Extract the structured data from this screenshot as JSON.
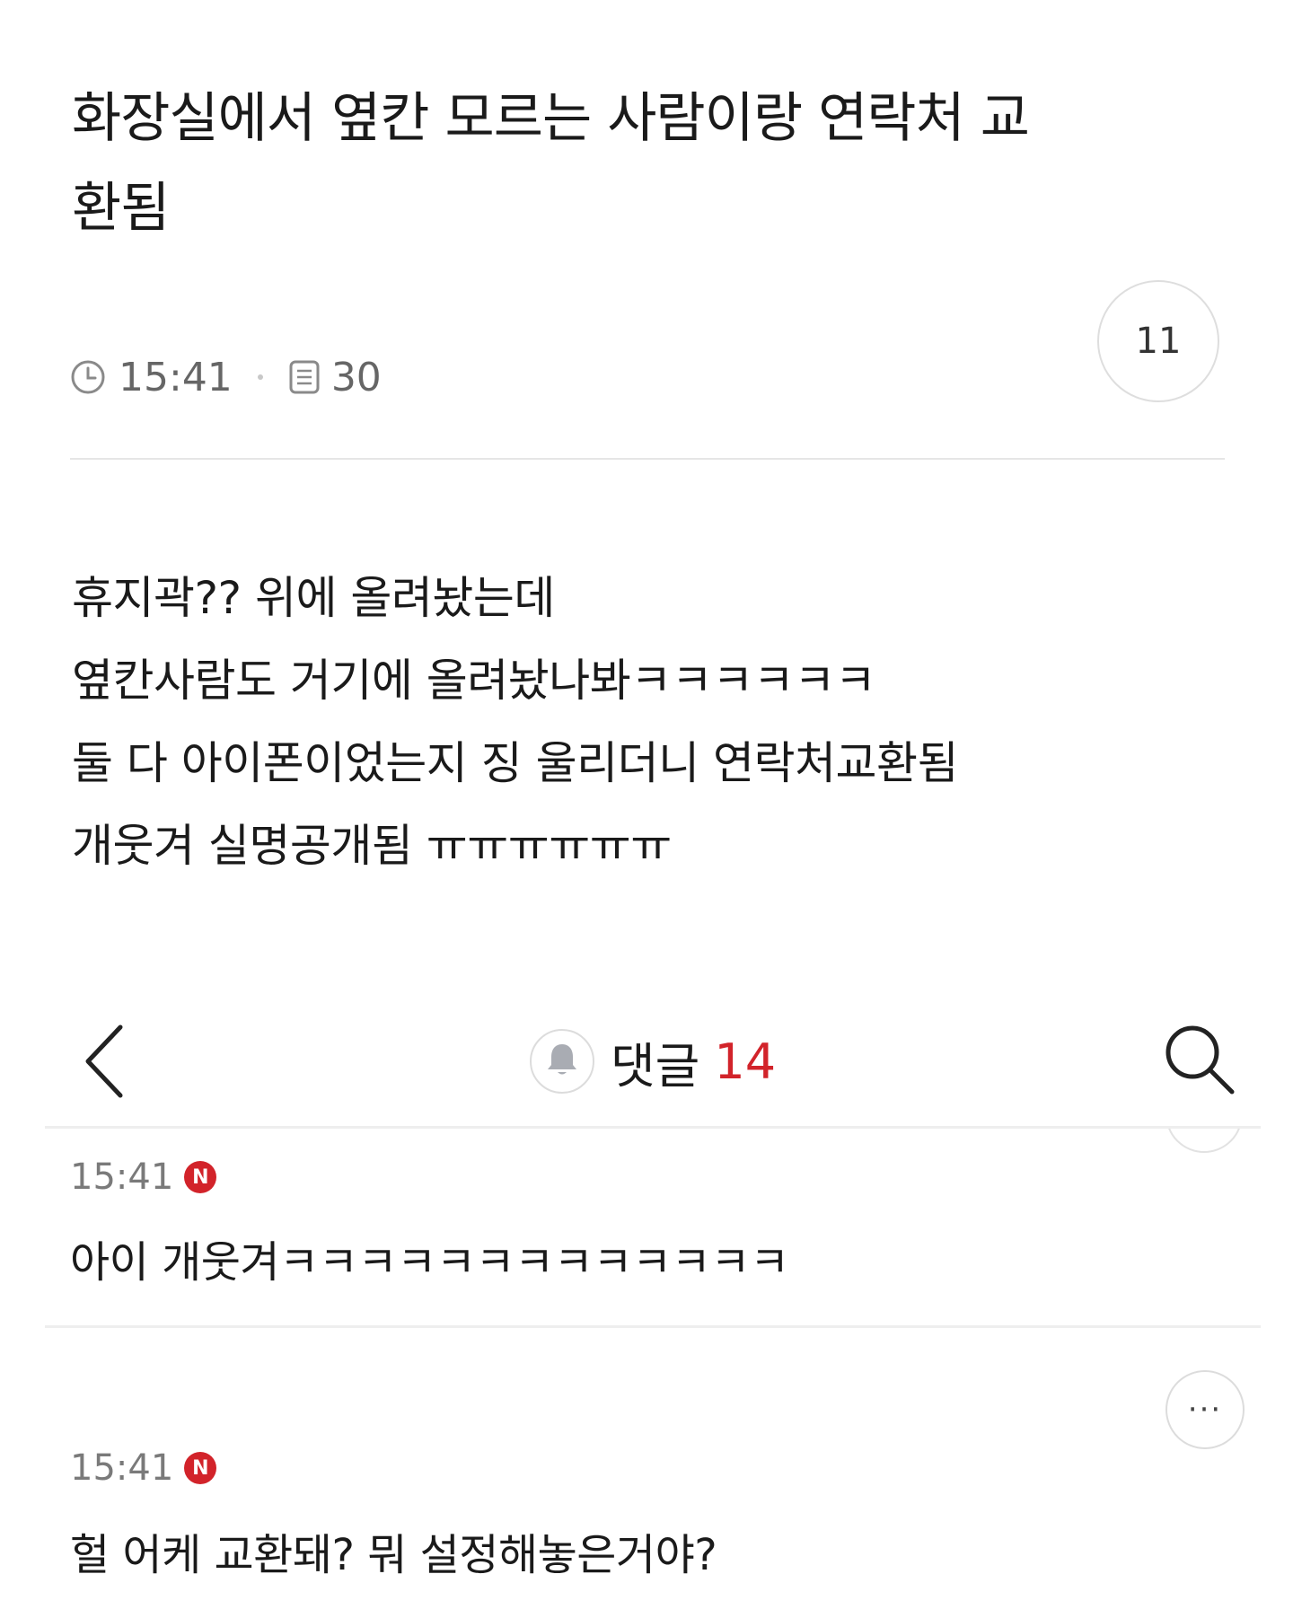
{
  "post": {
    "title": "화장실에서 옆칸 모르는 사람이랑 연락처 교환됨",
    "time": "15:41",
    "views": "30",
    "count": "11",
    "body": [
      "휴지곽?? 위에 올려놨는데",
      "옆칸사람도 거기에 올려놨나봐ㅋㅋㅋㅋㅋㅋ",
      "둘 다 아이폰이었는지 징 울리더니 연락처교환됨",
      "개웃겨 실명공개됨 ㅠㅠㅠㅠㅠㅠ"
    ]
  },
  "comments_header": {
    "label": "댓글",
    "count": "14",
    "count_color": "#d2232a"
  },
  "comments": [
    {
      "time": "15:41",
      "badge": "N",
      "text": "아이 개웃겨ㅋㅋㅋㅋㅋㅋㅋㅋㅋㅋㅋㅋㅋ"
    },
    {
      "time": "15:41",
      "badge": "N",
      "text": "헐 어케  교환돼? 뭐 설정해놓은거야?",
      "more": "···"
    }
  ],
  "icons": {
    "clock": "clock-icon",
    "views": "document-icon",
    "back": "chevron-left-icon",
    "bell": "bell-icon",
    "search": "search-icon",
    "more": "more-dots-icon"
  }
}
